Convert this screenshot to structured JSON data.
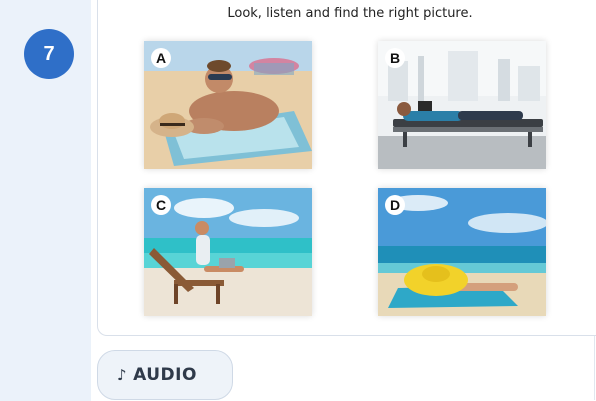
{
  "exercise": {
    "number": "7",
    "instruction": "Look, listen and find the right picture."
  },
  "pictures": [
    {
      "letter": "A",
      "scene": "man-sunbathing-on-beach-towel"
    },
    {
      "letter": "B",
      "scene": "man-lying-on-airport-bench"
    },
    {
      "letter": "C",
      "scene": "man-with-laptop-on-beach-chair"
    },
    {
      "letter": "D",
      "scene": "woman-in-yellow-hat-on-beach"
    }
  ],
  "audio": {
    "icon": "music-note-icon",
    "label": "AUDIO"
  },
  "colors": {
    "badge": "#2f6fc8",
    "rail": "#ebf2fa"
  }
}
